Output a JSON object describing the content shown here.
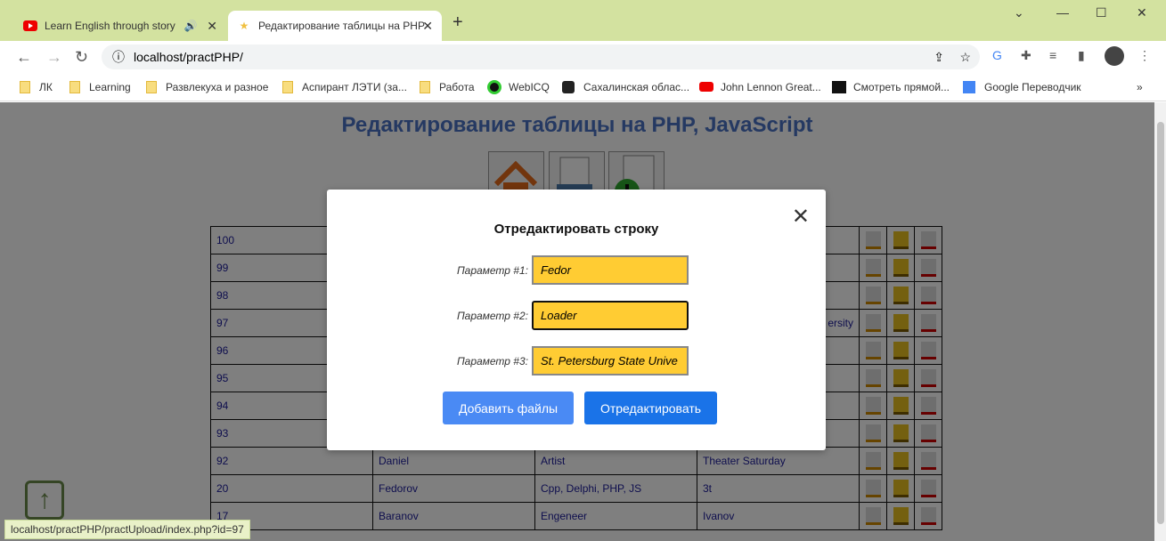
{
  "browser": {
    "tabs": [
      {
        "title": "Learn English through story",
        "active": false
      },
      {
        "title": "Редактирование таблицы на PHP",
        "active": true
      }
    ],
    "url": "localhost/practPHP/",
    "bookmarks": [
      "ЛК",
      "Learning",
      "Развлекуха и разное",
      "Аспирант ЛЭТИ (за...",
      "Работа",
      "WebICQ",
      "Сахалинская облас...",
      "John Lennon Great...",
      "Смотреть прямой...",
      "Google Переводчик"
    ],
    "status_url": "localhost/practPHP/practUpload/index.php?id=97"
  },
  "page": {
    "title": "Редактирование таблицы на PHP, JavaScript",
    "rows": [
      [
        "100",
        "",
        "",
        ""
      ],
      [
        "99",
        "",
        "",
        ""
      ],
      [
        "98",
        "",
        "",
        ""
      ],
      [
        "97",
        "",
        "",
        "ersity"
      ],
      [
        "96",
        "",
        "",
        ""
      ],
      [
        "95",
        "",
        "",
        ""
      ],
      [
        "94",
        "",
        "",
        ""
      ],
      [
        "93",
        "",
        "",
        ""
      ],
      [
        "92",
        "Daniel",
        "Artist",
        "Theater Saturday"
      ],
      [
        "20",
        "Fedorov",
        "Cpp, Delphi, PHP, JS",
        "3t"
      ],
      [
        "17",
        "Baranov",
        "Engeneer",
        "Ivanov"
      ]
    ]
  },
  "modal": {
    "title": "Отредактировать строку",
    "fields": [
      {
        "label": "Параметр #1:",
        "value": "Fedor"
      },
      {
        "label": "Параметр #2:",
        "value": "Loader"
      },
      {
        "label": "Параметр #3:",
        "value": "St. Petersburg State Unive"
      }
    ],
    "add_files": "Добавить файлы",
    "submit": "Отредактировать",
    "colors": {
      "input": "#ffcc33",
      "primary": "#1a73e8",
      "secondary": "#4a8af4"
    }
  }
}
